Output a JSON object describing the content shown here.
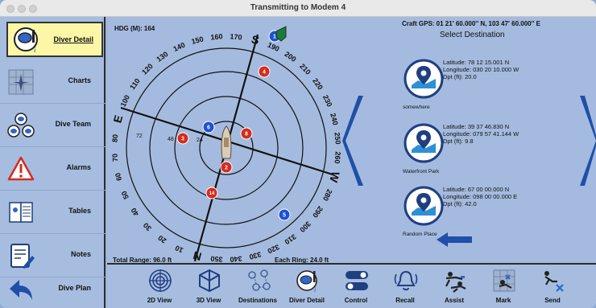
{
  "window": {
    "title": "Transmitting to Modem 4"
  },
  "sidebar": {
    "items": [
      {
        "label": "Diver Detail",
        "icon": "diver-detail-icon",
        "active": true
      },
      {
        "label": "Charts",
        "icon": "charts-icon"
      },
      {
        "label": "Dive Team",
        "icon": "dive-team-icon"
      },
      {
        "label": "Alarms",
        "icon": "alarm-icon"
      },
      {
        "label": "Tables",
        "icon": "tables-icon"
      },
      {
        "label": "Notes",
        "icon": "notes-icon"
      },
      {
        "label": "Dive Plan",
        "icon": "back-arrow-icon"
      }
    ]
  },
  "compass": {
    "heading": "HDG (M): 164",
    "total_range": "Total Range: 96.0 ft",
    "each_ring": "Each Ring: 24.0 ft",
    "dial_labels": [
      "100",
      "110",
      "120",
      "130",
      "140",
      "150",
      "160",
      "170",
      "S",
      "190",
      "200",
      "210",
      "220",
      "230",
      "240",
      "250",
      "260",
      "W",
      "280",
      "290",
      "300",
      "310",
      "320",
      "330",
      "340",
      "350",
      "N",
      "10",
      "20",
      "30",
      "40",
      "50",
      "60",
      "70",
      "80",
      "E"
    ],
    "ring_labels": [
      "72",
      "48",
      "24"
    ],
    "markers": [
      {
        "label": "1",
        "color": "#1f4fd6"
      },
      {
        "label": "2",
        "color": "#d52b1e"
      },
      {
        "label": "3",
        "color": "#d52b1e"
      },
      {
        "label": "4",
        "color": "#d52b1e"
      },
      {
        "label": "5",
        "color": "#1f4fd6"
      },
      {
        "label": "6",
        "color": "#1f4fd6"
      },
      {
        "label": "8",
        "color": "#d52b1e"
      },
      {
        "label": "14",
        "color": "#d52b1e"
      }
    ]
  },
  "gps": {
    "craft": "Craft GPS: 01 21' 60.000'' N, 103 47' 60.000'' E"
  },
  "destinations": {
    "title": "Select Destination",
    "items": [
      {
        "name": "somewhere",
        "lat": "Latitude: 78 12 15.001 N",
        "lon": "Longitude: 030 20 10.000 W",
        "dpt": "Dpt (ft): 20.0"
      },
      {
        "name": "Waterfront Park",
        "lat": "Latitude: 39 37 46.830 N",
        "lon": "Longitude: 079 57 41.144 W",
        "dpt": "Dpt (ft): 9.8"
      },
      {
        "name": "Random Place",
        "lat": "Latitude: 67 00 00.000 N",
        "lon": "Longitude: 098 00 00.000 E",
        "dpt": "Dpt (ft): 42.0"
      }
    ]
  },
  "toolbar": {
    "items": [
      {
        "label": "2D View",
        "icon": "target-icon"
      },
      {
        "label": "3D View",
        "icon": "cube-icon"
      },
      {
        "label": "Destinations",
        "icon": "destinations-icon"
      },
      {
        "label": "Diver Detail",
        "icon": "diver-detail-icon"
      },
      {
        "label": "Control",
        "icon": "toggle-icon"
      },
      {
        "label": "Recall",
        "icon": "recall-bell-icon"
      },
      {
        "label": "Assist",
        "icon": "assist-icon"
      },
      {
        "label": "Mark",
        "icon": "mark-icon"
      },
      {
        "label": "Send",
        "icon": "send-icon"
      }
    ]
  },
  "colors": {
    "accent": "#1f4fa8",
    "sidebar_bg": "#a6bde0",
    "active_bg": "#fbf7a6",
    "marker_red": "#d52b1e",
    "marker_blue": "#1f4fd6"
  }
}
